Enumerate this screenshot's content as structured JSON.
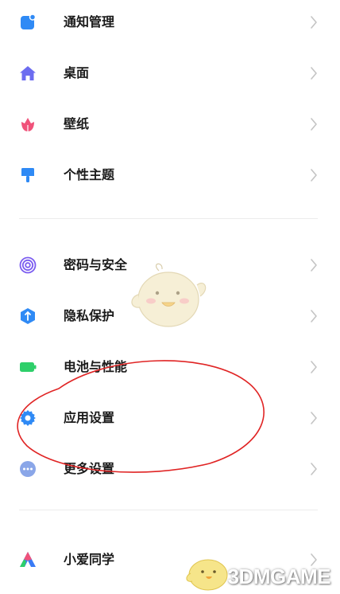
{
  "settings": {
    "group1": [
      {
        "label": "通知管理",
        "icon": "notification-icon",
        "color": "#2f8af5"
      },
      {
        "label": "桌面",
        "icon": "home-icon",
        "color": "#6c6cf0"
      },
      {
        "label": "壁纸",
        "icon": "tulip-icon",
        "color": "#f0527a"
      },
      {
        "label": "个性主题",
        "icon": "brush-icon",
        "color": "#2f8af5"
      }
    ],
    "group2": [
      {
        "label": "密码与安全",
        "icon": "fingerprint-icon",
        "color": "#7b5cf0"
      },
      {
        "label": "隐私保护",
        "icon": "privacy-shield-icon",
        "color": "#2f8af5"
      },
      {
        "label": "电池与性能",
        "icon": "battery-icon",
        "color": "#2ecf6a"
      },
      {
        "label": "应用设置",
        "icon": "gear-icon",
        "color": "#2f8af5"
      },
      {
        "label": "更多设置",
        "icon": "more-dots-icon",
        "color": "#8aa6e8"
      }
    ],
    "group3": [
      {
        "label": "小爱同学",
        "icon": "xiaoai-icon",
        "color": "#3a7bf5"
      }
    ]
  },
  "annotation": {
    "circled_item": "应用设置",
    "circle_color": "#e02424"
  },
  "watermark": {
    "text": "3DMGAME",
    "mascot": "chick-mascot"
  }
}
